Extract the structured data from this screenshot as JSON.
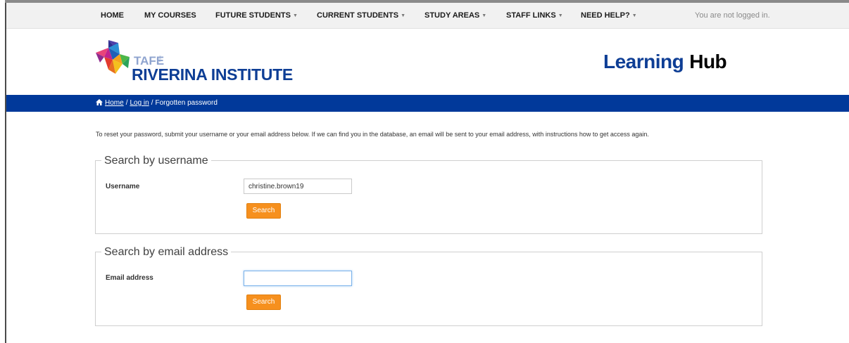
{
  "nav": {
    "items": [
      {
        "label": "HOME",
        "dropdown": false
      },
      {
        "label": "MY COURSES",
        "dropdown": false
      },
      {
        "label": "FUTURE STUDENTS",
        "dropdown": true
      },
      {
        "label": "CURRENT STUDENTS",
        "dropdown": true
      },
      {
        "label": "STUDY AREAS",
        "dropdown": true
      },
      {
        "label": "STAFF LINKS",
        "dropdown": true
      },
      {
        "label": "NEED HELP?",
        "dropdown": true
      }
    ],
    "login_status": "You are not logged in."
  },
  "header": {
    "logo_small": "TAFE",
    "logo_tick": "NSW",
    "logo_big": "RIVERINA INSTITUTE",
    "site_title_1": "Learning",
    "site_title_2": "Hub"
  },
  "breadcrumb": {
    "home": "Home",
    "login": "Log in",
    "current": "Forgotten password",
    "separator": "/"
  },
  "intro_text": "To reset your password, submit your username or your email address below. If we can find you in the database, an email will be sent to your email address, with instructions how to get access again.",
  "username_section": {
    "legend": "Search by username",
    "label": "Username",
    "value": "christine.brown19",
    "button": "Search"
  },
  "email_section": {
    "legend": "Search by email address",
    "label": "Email address",
    "value": "",
    "button": "Search"
  },
  "colors": {
    "brand_blue": "#01399a",
    "button_orange": "#f6901e",
    "nav_bg": "#f1f1f1"
  },
  "icons": {
    "breadcrumb_home": "home-icon",
    "dropdown": "caret-down-icon"
  }
}
